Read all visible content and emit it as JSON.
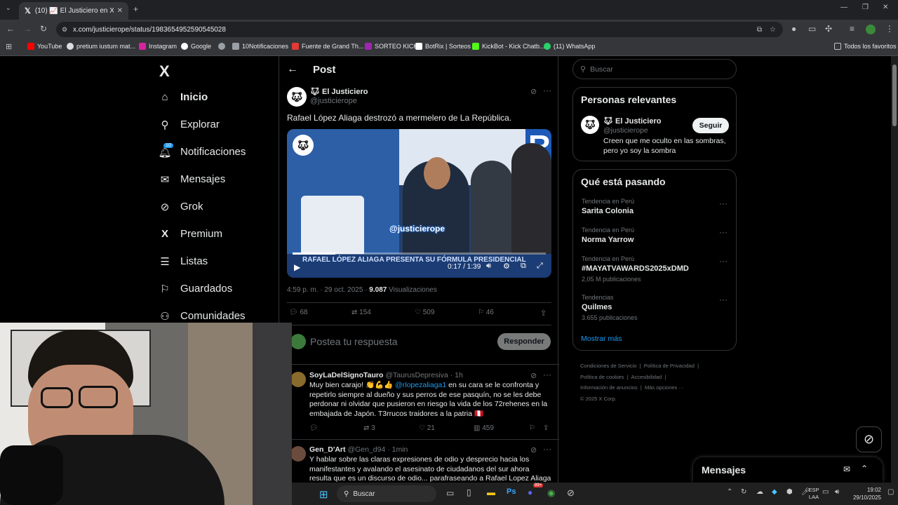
{
  "browser": {
    "tab_title": "(10) 📈 El Justiciero en X: \"Rafa",
    "url": "x.com/justicierope/status/1983654952590545028",
    "bookmarks": [
      "YouTube",
      "pretium iustum mat...",
      "Instagram",
      "Google",
      "",
      "10Notificaciones",
      "Fuente de Grand Th...",
      "SORTEO KICK",
      "BotRix | Sorteos",
      "KickBot - Kick Chatb...",
      "(11) WhatsApp"
    ],
    "all_bookmarks": "Todos los favoritos"
  },
  "nav": {
    "logo": "X",
    "notif_badge": "10",
    "items": [
      "Inicio",
      "Explorar",
      "Notificaciones",
      "Mensajes",
      "Grok",
      "Premium",
      "Listas",
      "Guardados",
      "Comunidades"
    ]
  },
  "post": {
    "header": "Post",
    "author_name": "El Justiciero",
    "author_handle": "@justicierope",
    "text": "Rafael López Aliaga destrozó a mermelero de La República.",
    "video_watermark": "@justicierope",
    "video_caption": "RAFAEL LÓPEZ ALIAGA PRESENTA SU FÓRMULA PRESIDENCIAL",
    "video_time": "0:17 / 1:39",
    "video_progress": 0.17,
    "timestamp": "4:59 p. m. · 29 oct. 2025 ·",
    "views_count": "9.087",
    "views_label": "Visualizaciones",
    "replies": "68",
    "reposts": "154",
    "likes": "509",
    "bookmarks": "46",
    "reply_placeholder": "Postea tu respuesta",
    "reply_button": "Responder"
  },
  "replies": [
    {
      "name": "SoyLaDelSignoTauro",
      "handle": "@TaurusDepresiva · 1h",
      "text_pre": "Muy bien carajo! 👏💪👍 ",
      "mention": "@rlopezaliaga1",
      "text_post": " en su cara se le confronta y repetirlo siempre al dueño y sus perros de ese pasquín,  no se les debe perdonar ni olvidar que pusieron en riesgo la vida de los 72rehenes en la embajada de Japón. T3rrucos traidores a la patria 🇵🇪",
      "reposts": "3",
      "likes": "21",
      "views": "459"
    },
    {
      "name": "Gen_D'Art",
      "handle": "@Gen_d94 · 1min",
      "text": "Y hablar sobre las claras expresiones de odio y desprecio hacia los manifestantes y avalando el asesinato de ciudadanos del sur ahora resulta que es un discurso de odio... parafraseando a Rafael Lopez Aliaga \"A esa"
    }
  ],
  "search_placeholder": "Buscar",
  "relevant": {
    "title": "Personas relevantes",
    "name": "El Justiciero",
    "handle": "@justicierope",
    "follow": "Seguir",
    "bio": "Creen que me oculto en las sombras, pero yo soy la sombra"
  },
  "trends": {
    "title": "Qué está pasando",
    "items": [
      {
        "context": "Tendencia en Perú",
        "name": "Sarita Colonia",
        "count": ""
      },
      {
        "context": "Tendencia en Perú",
        "name": "Norma Yarrow",
        "count": ""
      },
      {
        "context": "Tendencia en Perú",
        "name": "#MAYATVAWARDS2025xDMD",
        "count": "2,05 M publicaciones"
      },
      {
        "context": "Tendencias",
        "name": "Quilmes",
        "count": "3.655 publicaciones"
      }
    ],
    "more": "Mostrar más"
  },
  "footer": [
    "Condiciones de Servicio",
    "|",
    "Política de Privacidad",
    "|",
    "Política de cookies",
    "|",
    "Accesibilidad",
    "|",
    "Información de anuncios",
    "|",
    "Más opciones ···",
    "© 2025 X Corp."
  ],
  "messages_drawer": "Mensajes",
  "taskbar": {
    "search": "Buscar",
    "lang1": "ESP",
    "lang2": "LAA",
    "time": "19:02",
    "date": "29/10/2025",
    "discord_badge": "99+"
  }
}
